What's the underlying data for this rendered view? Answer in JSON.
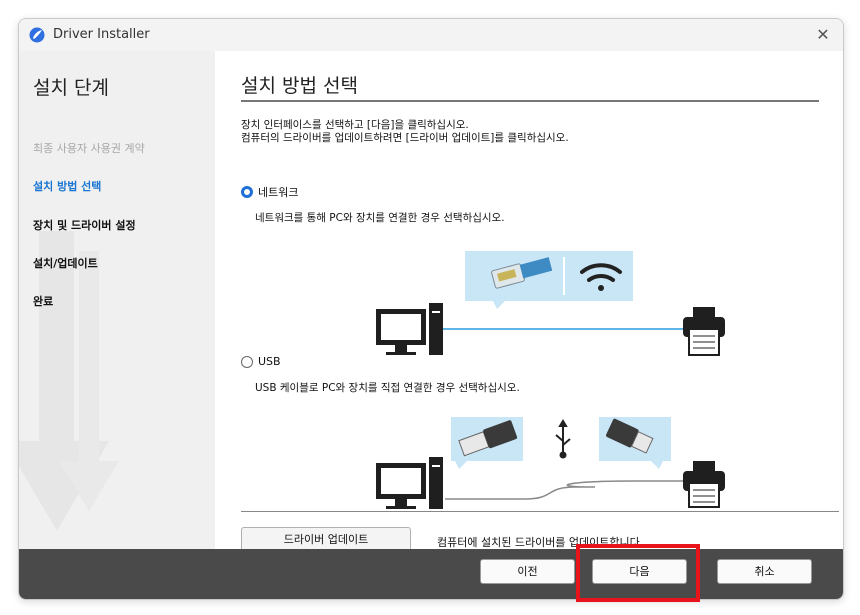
{
  "window": {
    "title": "Driver Installer",
    "close_icon": "close-icon"
  },
  "sidebar": {
    "heading": "설치 단계",
    "steps": [
      {
        "label": "최종 사용자 사용권 계약",
        "state": "done"
      },
      {
        "label": "설치 방법 선택",
        "state": "current"
      },
      {
        "label": "장치 및 드라이버 설정",
        "state": "todo"
      },
      {
        "label": "설치/업데이트",
        "state": "todo"
      },
      {
        "label": "완료",
        "state": "todo"
      }
    ]
  },
  "main": {
    "title": "설치 방법 선택",
    "instruction_line1": "장치 인터페이스를 선택하고 [다음]을 클릭하십시오.",
    "instruction_line2": "컴퓨터의 드라이버를 업데이트하려면 [드라이버 업데이트]를 클릭하십시오.",
    "options": [
      {
        "label": "네트워크",
        "selected": true,
        "description": "네트워크를 통해 PC와 장치를 연결한 경우 선택하십시오."
      },
      {
        "label": "USB",
        "selected": false,
        "description": "USB 케이블로 PC와 장치를 직접 연결한 경우 선택하십시오."
      }
    ],
    "update_button": "드라이버 업데이트",
    "update_description": "컴퓨터에 설치된 드라이버를 업데이트합니다."
  },
  "footer": {
    "back": "이전",
    "next": "다음",
    "cancel": "취소"
  },
  "colors": {
    "accent": "#1976d2",
    "highlight": "#e8141c",
    "footer": "#4a4a4a"
  }
}
